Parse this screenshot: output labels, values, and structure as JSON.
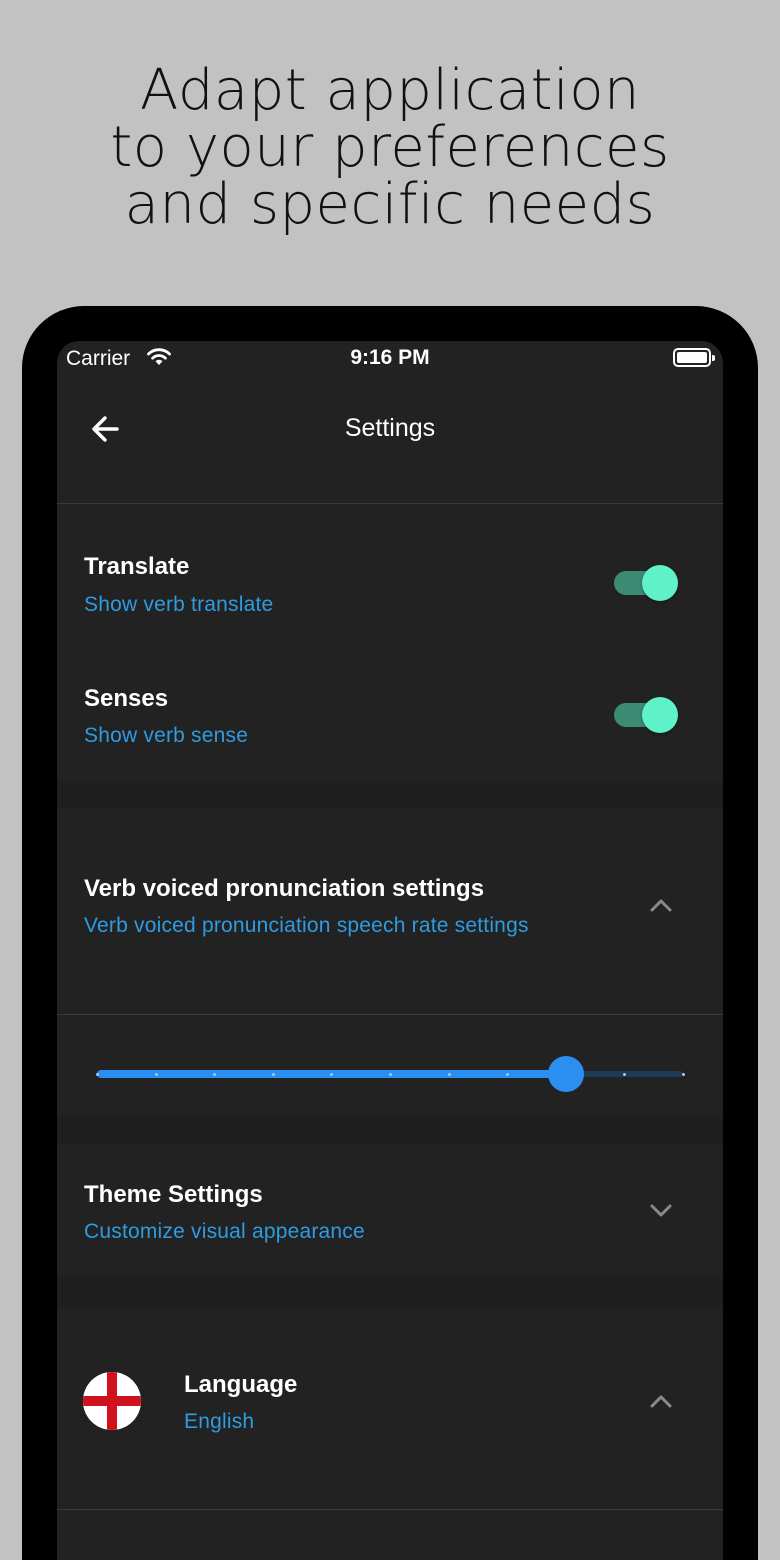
{
  "headline": {
    "line1": "Adapt application",
    "line2": "to your preferences",
    "line3": "and specific needs"
  },
  "status_bar": {
    "carrier": "Carrier",
    "time": "9:16 PM",
    "wifi_icon": "wifi-icon",
    "battery_icon": "battery-icon"
  },
  "header": {
    "title": "Settings",
    "back_icon": "arrow-left-icon"
  },
  "settings": {
    "translate": {
      "title": "Translate",
      "subtitle": "Show verb translate",
      "enabled": true
    },
    "senses": {
      "title": "Senses",
      "subtitle": "Show verb sense",
      "enabled": true
    },
    "pronunciation": {
      "title": "Verb voiced pronunciation settings",
      "subtitle": "Verb voiced pronunciation speech rate settings",
      "expanded": true,
      "chevron_icon": "chevron-up-icon",
      "speech_rate": {
        "min": 0,
        "max": 10,
        "value": 8,
        "fraction": 0.8
      }
    },
    "theme": {
      "title": "Theme Settings",
      "subtitle": "Customize visual appearance",
      "expanded": false,
      "chevron_icon": "chevron-down-icon"
    },
    "language": {
      "title": "Language",
      "value": "English",
      "flag_icon": "england-flag-icon",
      "chevron_icon": "chevron-up-icon"
    }
  },
  "colors": {
    "accent_text": "#2f9be0",
    "toggle_track": "#3c8c73",
    "toggle_knob": "#5ff2c9",
    "slider_active": "#2b8ff2",
    "background": "#222223"
  }
}
